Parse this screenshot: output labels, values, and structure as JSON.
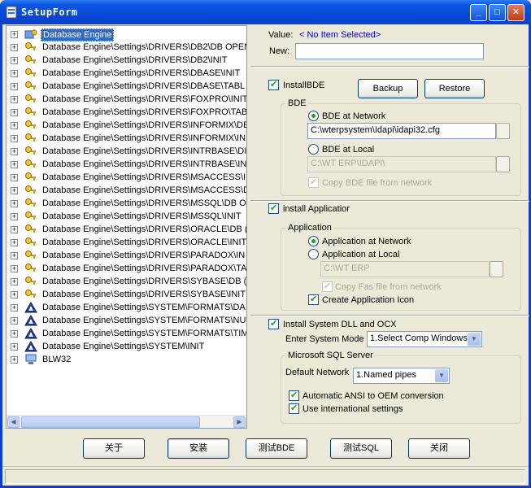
{
  "window": {
    "title": "SetupForm",
    "controls": {
      "minimize": "_",
      "maximize": "□",
      "close": "✕"
    }
  },
  "tree": {
    "items": [
      {
        "label": "Database Engine",
        "icon": "database-engine-icon",
        "selected": true
      },
      {
        "label": "Database Engine\\Settings\\DRIVERS\\DB2\\DB OPEN",
        "icon": "key-icon"
      },
      {
        "label": "Database Engine\\Settings\\DRIVERS\\DB2\\INIT",
        "icon": "key-icon"
      },
      {
        "label": "Database Engine\\Settings\\DRIVERS\\DBASE\\INIT",
        "icon": "key-icon"
      },
      {
        "label": "Database Engine\\Settings\\DRIVERS\\DBASE\\TABL",
        "icon": "key-icon"
      },
      {
        "label": "Database Engine\\Settings\\DRIVERS\\FOXPRO\\INIT",
        "icon": "key-icon"
      },
      {
        "label": "Database Engine\\Settings\\DRIVERS\\FOXPRO\\TAB",
        "icon": "key-icon"
      },
      {
        "label": "Database Engine\\Settings\\DRIVERS\\INFORMIX\\DE",
        "icon": "key-icon"
      },
      {
        "label": "Database Engine\\Settings\\DRIVERS\\INFORMIX\\IN",
        "icon": "key-icon"
      },
      {
        "label": "Database Engine\\Settings\\DRIVERS\\INTRBASE\\DI",
        "icon": "key-icon"
      },
      {
        "label": "Database Engine\\Settings\\DRIVERS\\INTRBASE\\IN",
        "icon": "key-icon"
      },
      {
        "label": "Database Engine\\Settings\\DRIVERS\\MSACCESS\\IN",
        "icon": "key-icon"
      },
      {
        "label": "Database Engine\\Settings\\DRIVERS\\MSACCESS\\D",
        "icon": "key-icon"
      },
      {
        "label": "Database Engine\\Settings\\DRIVERS\\MSSQL\\DB O",
        "icon": "key-icon"
      },
      {
        "label": "Database Engine\\Settings\\DRIVERS\\MSSQL\\INIT",
        "icon": "key-icon"
      },
      {
        "label": "Database Engine\\Settings\\DRIVERS\\ORACLE\\DB (",
        "icon": "key-icon"
      },
      {
        "label": "Database Engine\\Settings\\DRIVERS\\ORACLE\\INIT",
        "icon": "key-icon"
      },
      {
        "label": "Database Engine\\Settings\\DRIVERS\\PARADOX\\IN",
        "icon": "key-icon"
      },
      {
        "label": "Database Engine\\Settings\\DRIVERS\\PARADOX\\TA",
        "icon": "key-icon"
      },
      {
        "label": "Database Engine\\Settings\\DRIVERS\\SYBASE\\DB (",
        "icon": "key-icon"
      },
      {
        "label": "Database Engine\\Settings\\DRIVERS\\SYBASE\\INIT",
        "icon": "key-icon"
      },
      {
        "label": "Database Engine\\Settings\\SYSTEM\\FORMATS\\DA",
        "icon": "triangle-icon"
      },
      {
        "label": "Database Engine\\Settings\\SYSTEM\\FORMATS\\NU",
        "icon": "triangle-icon"
      },
      {
        "label": "Database Engine\\Settings\\SYSTEM\\FORMATS\\TIM",
        "icon": "triangle-icon"
      },
      {
        "label": "Database Engine\\Settings\\SYSTEM\\INIT",
        "icon": "triangle-icon"
      },
      {
        "label": "BLW32",
        "icon": "computer-icon"
      }
    ]
  },
  "value_panel": {
    "value_label": "Value:",
    "value_text": "< No Item Selected>",
    "new_label": "New:",
    "new_value": ""
  },
  "bde": {
    "install_label": "InstallBDE",
    "install_checked": true,
    "backup_label": "Backup",
    "restore_label": "Restore",
    "group_title": "BDE",
    "network_label": "BDE at Network",
    "network_path": "C:\\wterpsystem\\Idapi\\idapi32.cfg",
    "local_label": "BDE at Local",
    "local_path": "C:\\WT ERP\\IDAPI\\",
    "copy_label": "Copy BDE file from network"
  },
  "application": {
    "install_label": "install Applicatior",
    "install_checked": true,
    "group_title": "Application",
    "network_label": "Application at Network",
    "local_label": "Application at Local",
    "local_path": "C:\\WT ERP",
    "copy_label": "Copy Fas file from network",
    "icon_label": "Create Application Icon"
  },
  "system": {
    "install_label": "Install System DLL and OCX",
    "install_checked": true,
    "mode_label": "Enter System Mode",
    "mode_value": "1.Select Comp Windows"
  },
  "sqlserver": {
    "group_title": "Microsoft SQL Server",
    "network_label": "Default Network",
    "network_value": "1.Named pipes",
    "ansi_label": "Automatic ANSI to OEM conversion",
    "intl_label": "Use international settings"
  },
  "buttons": {
    "about": "关于",
    "install": "安装",
    "test_bde": "测试BDE",
    "test_sql": "测试SQL",
    "close": "关闭"
  },
  "colors": {
    "titlebar": "#0549d6",
    "selection": "#316ac5",
    "window_bg": "#ece9d8",
    "check": "#21a121"
  }
}
